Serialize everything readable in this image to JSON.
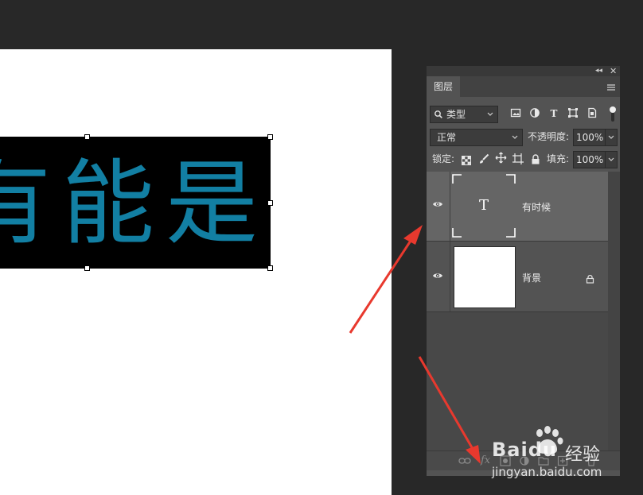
{
  "canvas": {
    "text": "有能是",
    "text_color": "#127fa3",
    "background": "#ffffff"
  },
  "panel": {
    "tab_label": "图层",
    "collapse_icon": "double-chevron-left-icon",
    "close_icon": "close-icon",
    "menu_icon": "hamburger-menu-icon",
    "filter": {
      "search_icon": "search-icon",
      "kind_value": "类型",
      "filter_icons": [
        "image-filter-icon",
        "adjustment-filter-icon",
        "type-filter-icon",
        "shape-filter-icon",
        "smart-object-filter-icon"
      ],
      "toggle_icon": "filter-toggle-icon"
    },
    "blend": {
      "mode_value": "正常",
      "opacity_label": "不透明度:",
      "opacity_value": "100%"
    },
    "lock": {
      "label": "锁定:",
      "fill_label": "填充:",
      "fill_value": "100%"
    },
    "layers": [
      {
        "name": "有时候",
        "type": "text",
        "thumb_glyph": "T",
        "selected": true,
        "visible": true
      },
      {
        "name": "背景",
        "type": "background",
        "selected": false,
        "visible": true,
        "locked": true
      }
    ],
    "footer_icons": [
      "link-layers-icon",
      "fx-icon",
      "add-mask-icon",
      "adjustment-layer-icon",
      "group-icon",
      "new-layer-icon",
      "delete-layer-icon"
    ]
  },
  "annotations": {
    "arrow_color": "#e8392e"
  },
  "watermark": {
    "brand": "Baidu",
    "brand_suffix": "经验",
    "url": "jingyan.baidu.com"
  }
}
